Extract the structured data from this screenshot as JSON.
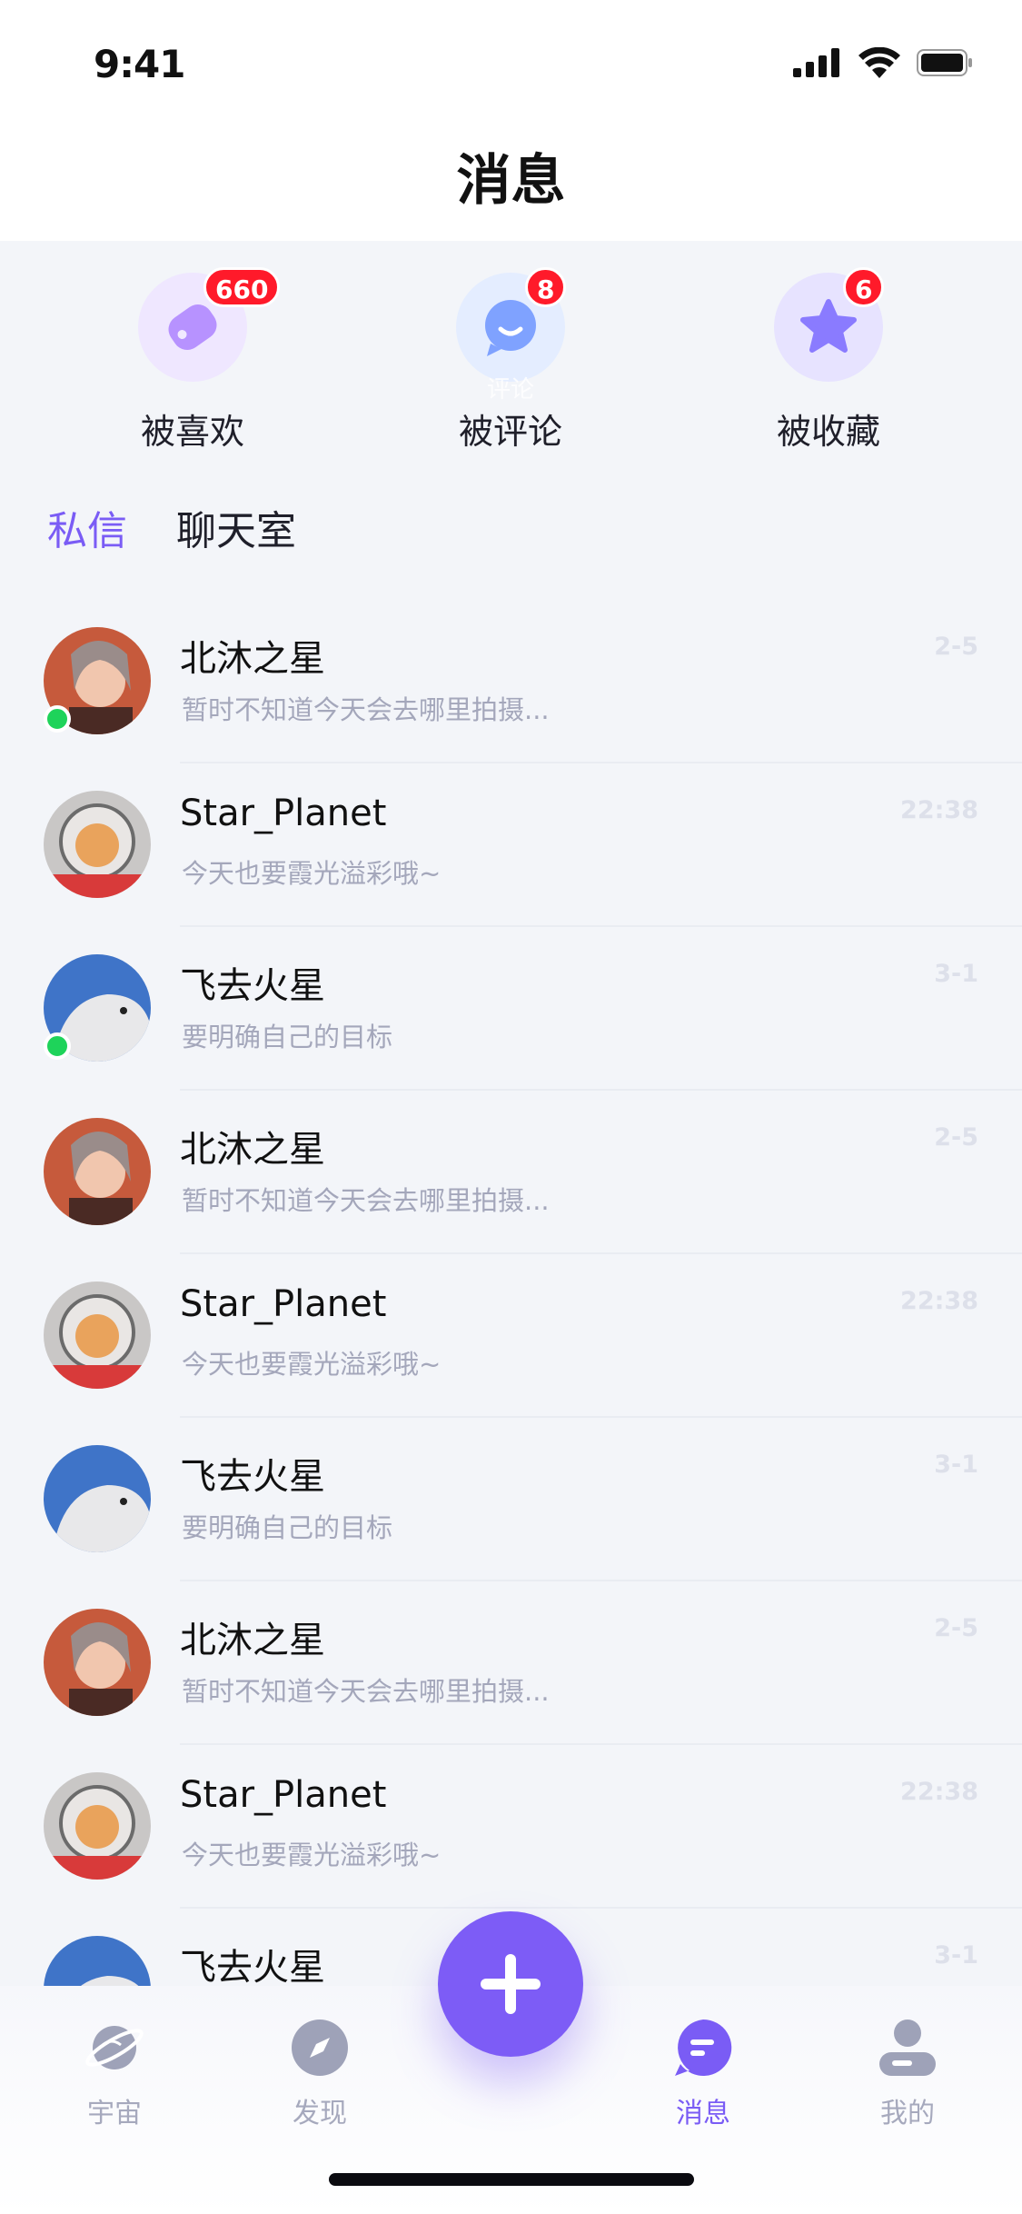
{
  "status": {
    "time": "9:41"
  },
  "header": {
    "title": "消息"
  },
  "categories": [
    {
      "label": "被喜欢",
      "badge": "660",
      "icon": "heart-tag-icon",
      "color": "#c9a6ff"
    },
    {
      "label": "被评论",
      "badge": "8",
      "icon": "comment-bubble-icon",
      "color": "#8bb0ff",
      "watermark": "评论"
    },
    {
      "label": "被收藏",
      "badge": "6",
      "icon": "star-icon",
      "color": "#9b8bff"
    }
  ],
  "tabs": [
    {
      "label": "私信",
      "active": true
    },
    {
      "label": "聊天室",
      "active": false
    }
  ],
  "conversations": [
    {
      "name": "北沐之星",
      "preview": "暂时不知道今天会去哪里拍摄...",
      "time": "2-5",
      "online": true,
      "avatar": "woman-portrait"
    },
    {
      "name": "Star_Planet",
      "preview": "今天也要霞光溢彩哦~",
      "time": "22:38",
      "online": false,
      "avatar": "cat-astronaut"
    },
    {
      "name": "飞去火星",
      "preview": "要明确自己的目标",
      "time": "3-1",
      "online": true,
      "avatar": "white-dog"
    },
    {
      "name": "北沐之星",
      "preview": "暂时不知道今天会去哪里拍摄...",
      "time": "2-5",
      "online": false,
      "avatar": "woman-portrait"
    },
    {
      "name": "Star_Planet",
      "preview": "今天也要霞光溢彩哦~",
      "time": "22:38",
      "online": false,
      "avatar": "cat-astronaut"
    },
    {
      "name": "飞去火星",
      "preview": "要明确自己的目标",
      "time": "3-1",
      "online": false,
      "avatar": "white-dog"
    },
    {
      "name": "北沐之星",
      "preview": "暂时不知道今天会去哪里拍摄...",
      "time": "2-5",
      "online": false,
      "avatar": "woman-portrait"
    },
    {
      "name": "Star_Planet",
      "preview": "今天也要霞光溢彩哦~",
      "time": "22:38",
      "online": false,
      "avatar": "cat-astronaut"
    },
    {
      "name": "飞去火星",
      "preview": "",
      "time": "3-1",
      "online": false,
      "avatar": "white-dog"
    }
  ],
  "nav": [
    {
      "label": "宇宙",
      "icon": "planet-icon",
      "active": false
    },
    {
      "label": "发现",
      "icon": "compass-icon",
      "active": false
    },
    {
      "label": "消息",
      "icon": "chat-icon",
      "active": true
    },
    {
      "label": "我的",
      "icon": "user-icon",
      "active": false
    }
  ],
  "colors": {
    "accent": "#7a5cf5",
    "badge": "#ff1a2a",
    "online": "#1ed35a"
  }
}
